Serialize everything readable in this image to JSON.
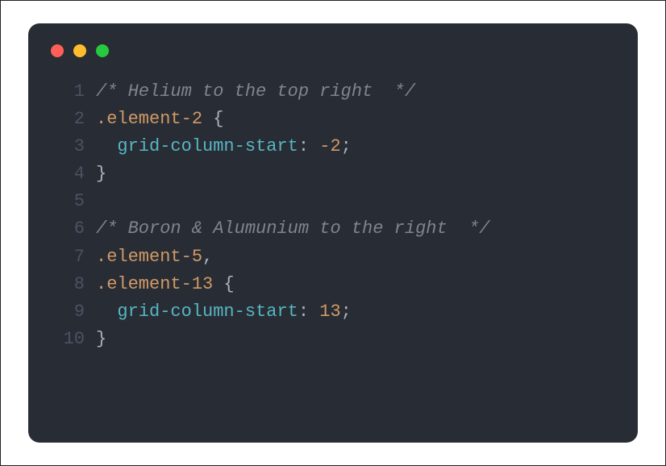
{
  "window": {
    "traffic_lights": {
      "red": "#ff5f56",
      "yellow": "#ffbd2e",
      "green": "#27c93f"
    }
  },
  "code": {
    "language": "css",
    "lines": [
      {
        "num": "1",
        "tokens": [
          {
            "cls": "tok-comment",
            "text": "/* Helium to the top right  */"
          }
        ]
      },
      {
        "num": "2",
        "tokens": [
          {
            "cls": "tok-selector",
            "text": ".element-2"
          },
          {
            "cls": "tok-punc",
            "text": " {"
          }
        ]
      },
      {
        "num": "3",
        "tokens": [
          {
            "cls": "tok-punc",
            "text": "  "
          },
          {
            "cls": "tok-prop",
            "text": "grid-column-start"
          },
          {
            "cls": "tok-punc",
            "text": ": "
          },
          {
            "cls": "tok-number",
            "text": "-2"
          },
          {
            "cls": "tok-punc",
            "text": ";"
          }
        ]
      },
      {
        "num": "4",
        "tokens": [
          {
            "cls": "tok-punc",
            "text": "}"
          }
        ]
      },
      {
        "num": "5",
        "tokens": [
          {
            "cls": "tok-punc",
            "text": ""
          }
        ]
      },
      {
        "num": "6",
        "tokens": [
          {
            "cls": "tok-comment",
            "text": "/* Boron & Alumunium to the right  */"
          }
        ]
      },
      {
        "num": "7",
        "tokens": [
          {
            "cls": "tok-selector",
            "text": ".element-5"
          },
          {
            "cls": "tok-punc",
            "text": ","
          }
        ]
      },
      {
        "num": "8",
        "tokens": [
          {
            "cls": "tok-selector",
            "text": ".element-13"
          },
          {
            "cls": "tok-punc",
            "text": " {"
          }
        ]
      },
      {
        "num": "9",
        "tokens": [
          {
            "cls": "tok-punc",
            "text": "  "
          },
          {
            "cls": "tok-prop",
            "text": "grid-column-start"
          },
          {
            "cls": "tok-punc",
            "text": ": "
          },
          {
            "cls": "tok-number",
            "text": "13"
          },
          {
            "cls": "tok-punc",
            "text": ";"
          }
        ]
      },
      {
        "num": "10",
        "tokens": [
          {
            "cls": "tok-punc",
            "text": "}"
          }
        ]
      }
    ]
  }
}
